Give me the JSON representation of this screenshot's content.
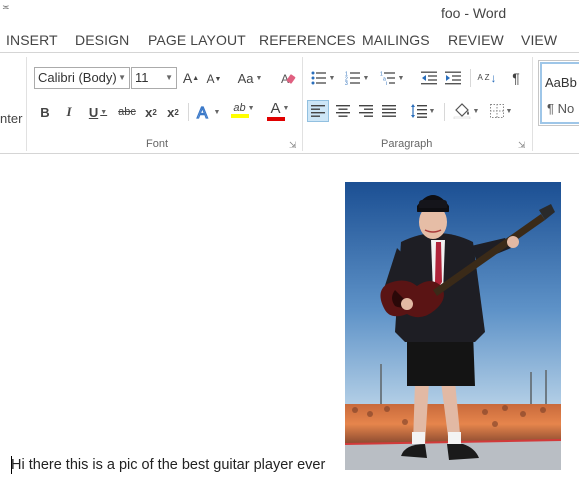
{
  "window": {
    "title": "foo - Word"
  },
  "tabs": [
    {
      "label": "INSERT"
    },
    {
      "label": "DESIGN"
    },
    {
      "label": "PAGE LAYOUT"
    },
    {
      "label": "REFERENCES"
    },
    {
      "label": "MAILINGS"
    },
    {
      "label": "REVIEW"
    },
    {
      "label": "VIEW"
    }
  ],
  "clipboard": {
    "partial_label": "nter"
  },
  "font_group": {
    "label": "Font",
    "font_name": "Calibri (Body)",
    "font_size": "11",
    "grow_label": "A",
    "shrink_label": "A",
    "case_label": "Aa",
    "bold": "B",
    "italic": "I",
    "underline": "U",
    "strikethrough": "abc",
    "subscript": "x",
    "subscript_small": "2",
    "superscript": "x",
    "superscript_small": "2",
    "highlight_label": "ab",
    "font_color_label": "A",
    "highlight_color": "#ffff00",
    "font_color": "#e00000"
  },
  "paragraph_group": {
    "label": "Paragraph",
    "sort_label": "A Z",
    "pilcrow": "¶"
  },
  "styles_group": {
    "style_preview": "AaBb",
    "style_name": "¶ No"
  },
  "document": {
    "text": "Hi there this is a pic of the best guitar player ever"
  }
}
